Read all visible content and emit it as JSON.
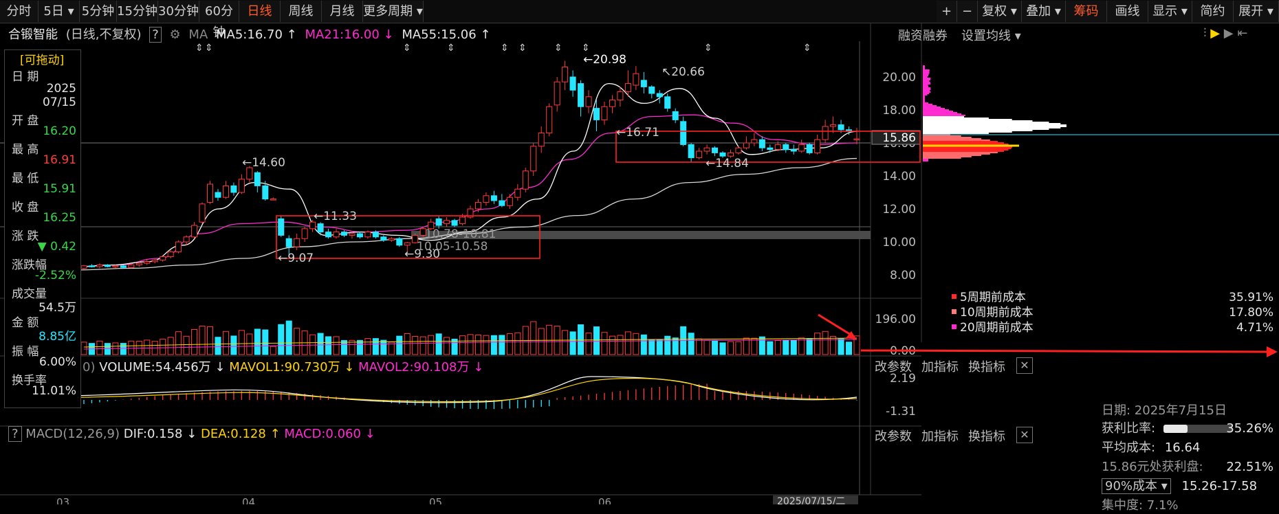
{
  "toolbar": {
    "left": [
      "分时",
      "5日 ▾",
      "5分钟",
      "15分钟",
      "30分钟",
      "60分钟",
      "日线",
      "周线",
      "月线",
      "更多周期 ▾"
    ],
    "active": "日线",
    "right": [
      "+",
      "−",
      "复权 ▾",
      "叠加 ▾",
      "筹码",
      "画线",
      "显示 ▾",
      "简约",
      "展开 ▾"
    ],
    "right_active": "筹码"
  },
  "info": {
    "name": "合锻智能",
    "mode": "(日线,不复权)",
    "help": "?",
    "ma_label": "MA",
    "ma5": "MA5:16.70 ↑",
    "ma21": "MA21:16.00 ↓",
    "ma55": "MA55:15.06 ↑",
    "margin": "融资融券",
    "set_ma": "设置均线 ▾"
  },
  "side": {
    "drag": "[可拖动]",
    "date_k": "日 期",
    "year": "2025",
    "date": "07/15",
    "open_k": "开 盘",
    "open": "16.20",
    "high_k": "最 高",
    "high": "16.91",
    "low_k": "最 低",
    "low": "15.91",
    "close_k": "收 盘",
    "close": "16.25",
    "chg_k": "涨 跌",
    "chg": "▼ 0.42",
    "pct_k": "涨跌幅",
    "pct": "-2.52%",
    "vol_k": "成交量",
    "vol": "54.5万",
    "amt_k": "金 额",
    "amt": "8.85亿",
    "amp_k": "振 幅",
    "amp": "6.00%",
    "turn_k": "换手率",
    "turn": "11.01%"
  },
  "price_axis": [
    "20.00",
    "18.00",
    "16.00",
    "14.00",
    "12.00",
    "10.00",
    "8.00"
  ],
  "current_price": "15.86",
  "annotations": {
    "high1": "←14.60",
    "low1": "←9.07",
    "mid1": "←11.33",
    "low2": "←9.30",
    "high2": "←20.98",
    "high3": "↖20.66",
    "mid2": "←16.71",
    "low3": "←14.84",
    "band1": "10.78-10.81",
    "band2": "10.05-10.58",
    "left_edge": "0"
  },
  "volume": {
    "title_prefix": "0)",
    "vol": "VOLUME:54.456万 ↓",
    "mavol1": "MAVOL1:90.730万 ↓",
    "mavol2": "MAVOL2:90.108万 ↓",
    "axis_top": "196.00",
    "axis_bottom": "0.00",
    "buttons": [
      "改参数",
      "加指标",
      "换指标"
    ]
  },
  "macd": {
    "help": "?",
    "title": "MACD(12,26,9)",
    "dif": "DIF:0.158 ↓",
    "dea": "DEA:0.128 ↑",
    "macd": "MACD:0.060 ↓",
    "axis_top": "2.19",
    "axis_bottom": "-1.31",
    "buttons": [
      "改参数",
      "加指标",
      "换指标"
    ]
  },
  "xaxis": [
    "03",
    "04",
    "05",
    "06"
  ],
  "xaxis_date": "2025/07/15/二",
  "chip": {
    "legend": [
      {
        "label": "5周期前成本",
        "value": "35.91%",
        "color": "#ff2a2a"
      },
      {
        "label": "10周期前成本",
        "value": "17.80%",
        "color": "#ff7a7a"
      },
      {
        "label": "20周期前成本",
        "value": "4.71%",
        "color": "#ff2bd0"
      }
    ],
    "date": "日期: 2025年7月15日",
    "profit_k": "获利比率:",
    "profit": "35.26%",
    "profit_ratio": 0.35,
    "avg_k": "平均成本:",
    "avg": "16.64",
    "at_price": "15.86元处获利盘:",
    "at_price_v": "22.51%",
    "cost_sel": "90%成本 ▾",
    "cost_range": "15.26-17.58",
    "concentration": "集中度: 7.1%"
  },
  "colors": {
    "up": "#ff3b3b",
    "down": "#26e6ff",
    "ma5": "#ffffff",
    "ma21": "#ff2bd0",
    "ma55": "#d8d8d8",
    "yellow": "#ffd400"
  },
  "chart_data": {
    "type": "candlestick",
    "title": "合锻智能 (日线,不复权)",
    "ylim": [
      7.5,
      21.5
    ],
    "candles": [
      [
        8.4,
        8.55,
        8.35,
        8.6
      ],
      [
        8.55,
        8.5,
        8.45,
        8.65
      ],
      [
        8.5,
        8.6,
        8.4,
        8.7
      ],
      [
        8.6,
        8.5,
        8.45,
        8.65
      ],
      [
        8.5,
        8.55,
        8.4,
        8.62
      ],
      [
        8.55,
        8.45,
        8.4,
        8.6
      ],
      [
        8.45,
        8.6,
        8.4,
        8.7
      ],
      [
        8.6,
        8.7,
        8.5,
        8.8
      ],
      [
        8.7,
        8.8,
        8.6,
        8.95
      ],
      [
        8.8,
        8.9,
        8.7,
        9.0
      ],
      [
        8.9,
        9.1,
        8.8,
        9.2
      ],
      [
        9.1,
        9.4,
        9.0,
        9.5
      ],
      [
        9.4,
        10.0,
        9.3,
        10.1
      ],
      [
        10.0,
        10.3,
        9.8,
        10.4
      ],
      [
        10.3,
        11.0,
        10.2,
        11.2
      ],
      [
        11.2,
        12.3,
        11.1,
        12.4
      ],
      [
        12.4,
        13.5,
        12.3,
        13.7
      ],
      [
        13.0,
        12.7,
        12.5,
        13.2
      ],
      [
        12.7,
        13.4,
        12.6,
        13.7
      ],
      [
        13.4,
        13.0,
        12.8,
        13.6
      ],
      [
        13.0,
        13.8,
        12.9,
        14.1
      ],
      [
        13.8,
        14.5,
        13.6,
        14.6
      ],
      [
        14.2,
        13.4,
        13.0,
        14.3
      ],
      [
        13.4,
        12.6,
        12.5,
        13.7
      ],
      [
        12.6,
        12.6,
        12.6,
        12.7
      ],
      [
        11.4,
        10.4,
        10.3,
        11.6
      ],
      [
        10.2,
        9.7,
        9.07,
        10.4
      ],
      [
        9.7,
        10.2,
        9.5,
        10.5
      ],
      [
        10.2,
        10.8,
        10.0,
        10.9
      ],
      [
        10.8,
        11.2,
        10.6,
        11.33
      ],
      [
        11.1,
        10.6,
        10.4,
        11.2
      ],
      [
        10.6,
        10.3,
        10.2,
        10.8
      ],
      [
        10.3,
        10.6,
        10.2,
        10.8
      ],
      [
        10.6,
        10.4,
        10.3,
        10.7
      ],
      [
        10.4,
        10.5,
        10.2,
        10.6
      ],
      [
        10.5,
        10.3,
        10.2,
        10.6
      ],
      [
        10.3,
        10.6,
        10.2,
        10.7
      ],
      [
        10.6,
        10.3,
        10.2,
        10.7
      ],
      [
        10.3,
        10.1,
        10.0,
        10.4
      ],
      [
        10.1,
        10.2,
        10.0,
        10.3
      ],
      [
        10.2,
        9.8,
        9.7,
        10.3
      ],
      [
        9.8,
        9.95,
        9.3,
        10.0
      ],
      [
        9.95,
        10.4,
        9.9,
        10.5
      ],
      [
        10.4,
        10.8,
        10.3,
        10.9
      ],
      [
        10.8,
        11.2,
        10.7,
        11.4
      ],
      [
        11.4,
        11.0,
        10.8,
        11.6
      ],
      [
        11.1,
        11.3,
        10.9,
        11.5
      ],
      [
        11.3,
        11.0,
        10.9,
        11.4
      ],
      [
        11.1,
        11.5,
        11.0,
        11.7
      ],
      [
        11.5,
        12.0,
        11.4,
        12.2
      ],
      [
        12.0,
        12.4,
        11.8,
        12.6
      ],
      [
        12.4,
        12.8,
        12.2,
        13.0
      ],
      [
        12.8,
        12.5,
        12.3,
        13.1
      ],
      [
        12.5,
        12.2,
        12.1,
        12.9
      ],
      [
        12.2,
        12.7,
        12.0,
        12.9
      ],
      [
        12.7,
        13.2,
        12.5,
        13.5
      ],
      [
        13.2,
        14.3,
        13.0,
        14.5
      ],
      [
        14.3,
        15.8,
        14.0,
        16.0
      ],
      [
        15.8,
        16.6,
        15.4,
        17.0
      ],
      [
        16.6,
        18.2,
        16.4,
        18.4
      ],
      [
        18.3,
        19.7,
        17.9,
        20.0
      ],
      [
        19.7,
        20.6,
        19.2,
        20.98
      ],
      [
        20.0,
        19.2,
        18.8,
        20.4
      ],
      [
        19.6,
        18.2,
        17.6,
        19.8
      ],
      [
        18.2,
        18.8,
        17.8,
        19.2
      ],
      [
        18.1,
        17.4,
        16.71,
        18.6
      ],
      [
        17.4,
        18.2,
        17.1,
        18.5
      ],
      [
        18.2,
        18.6,
        17.8,
        18.9
      ],
      [
        18.6,
        19.1,
        18.2,
        19.4
      ],
      [
        19.1,
        19.6,
        18.8,
        20.4
      ],
      [
        19.5,
        20.2,
        19.2,
        20.66
      ],
      [
        19.8,
        19.4,
        19.0,
        20.3
      ],
      [
        19.4,
        19.0,
        18.7,
        19.5
      ],
      [
        19.0,
        18.8,
        18.4,
        19.2
      ],
      [
        18.8,
        18.1,
        17.9,
        19.0
      ],
      [
        17.9,
        17.4,
        17.2,
        18.1
      ],
      [
        17.3,
        15.9,
        15.8,
        17.6
      ],
      [
        15.9,
        15.1,
        14.84,
        16.0
      ],
      [
        15.1,
        15.5,
        15.0,
        15.7
      ],
      [
        15.5,
        15.7,
        15.3,
        15.9
      ],
      [
        15.7,
        15.4,
        15.2,
        15.8
      ],
      [
        15.4,
        15.2,
        15.1,
        15.5
      ],
      [
        15.2,
        15.4,
        15.1,
        15.6
      ],
      [
        15.4,
        15.7,
        15.3,
        15.8
      ],
      [
        15.7,
        16.0,
        15.6,
        16.4
      ],
      [
        16.0,
        16.2,
        15.8,
        16.6
      ],
      [
        16.2,
        15.7,
        15.5,
        16.4
      ],
      [
        15.7,
        15.6,
        15.4,
        15.9
      ],
      [
        15.6,
        15.9,
        15.5,
        16.1
      ],
      [
        15.9,
        15.6,
        15.4,
        16.0
      ],
      [
        15.6,
        15.5,
        15.3,
        15.9
      ],
      [
        15.5,
        15.9,
        15.4,
        16.2
      ],
      [
        15.9,
        15.4,
        15.3,
        16.0
      ],
      [
        15.4,
        16.2,
        15.3,
        16.5
      ],
      [
        16.2,
        17.0,
        16.0,
        17.4
      ],
      [
        17.0,
        17.1,
        16.6,
        17.6
      ],
      [
        17.1,
        16.8,
        16.6,
        17.4
      ],
      [
        16.8,
        16.7,
        16.5,
        17.0
      ],
      [
        16.2,
        16.25,
        15.91,
        16.91
      ]
    ],
    "ma5_sample": [
      8.5,
      8.6,
      8.8,
      9.8,
      12.0,
      13.6,
      13.2,
      10.4,
      10.6,
      10.4,
      10.1,
      10.6,
      11.5,
      12.6,
      15.5,
      19.6,
      18.4,
      19.3,
      17.5,
      15.3,
      15.6,
      15.7,
      16.7
    ],
    "ma21_sample": [
      8.5,
      8.6,
      9.0,
      10.5,
      11.1,
      11.2,
      10.9,
      10.6,
      10.7,
      11.2,
      12.0,
      13.3,
      15.0,
      16.6,
      17.6,
      17.7,
      17.2,
      16.2,
      15.9,
      16.0
    ],
    "ma55_sample": [
      8.3,
      8.4,
      8.6,
      9.0,
      9.7,
      10.0,
      10.2,
      10.5,
      10.9,
      11.6,
      12.6,
      13.6,
      14.1,
      14.5,
      15.06
    ]
  }
}
